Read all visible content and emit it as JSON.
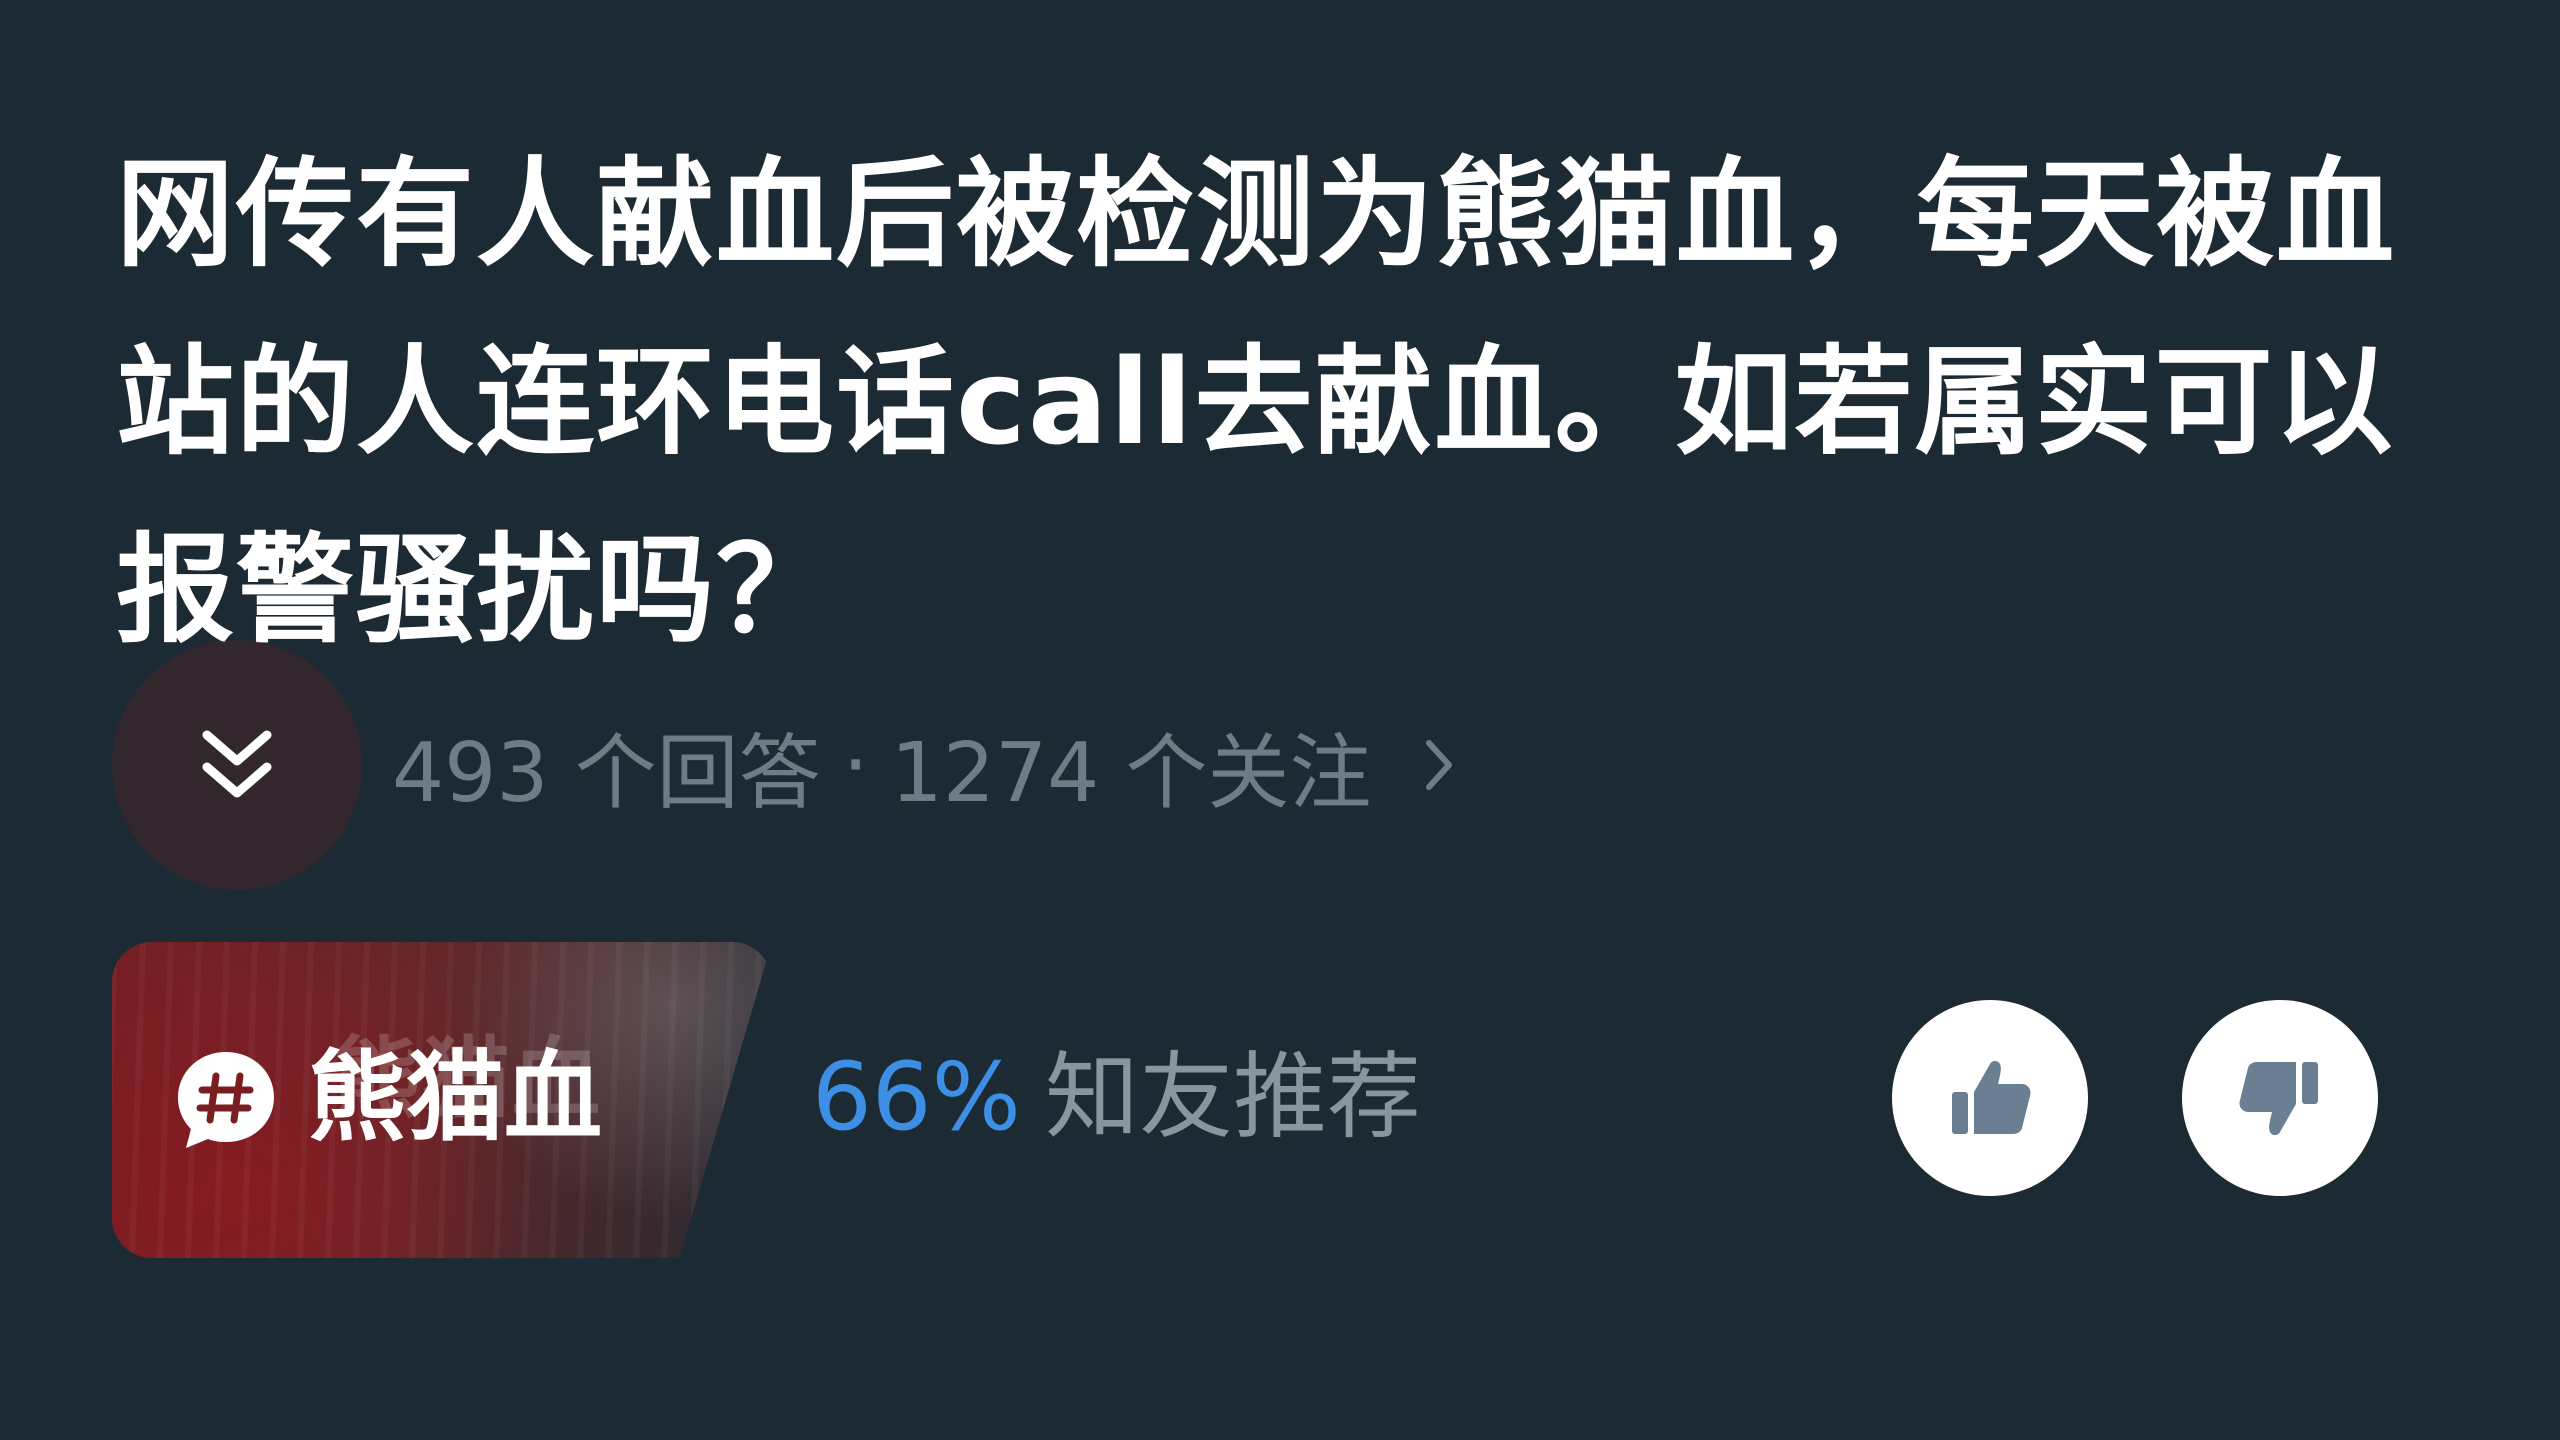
{
  "question": {
    "title": "网传有人献血后被检测为熊猫血，每天被血站的人连环电话call去献血。如若属实可以报警骚扰吗？"
  },
  "meta": {
    "answers": "493 个回答",
    "separator": "·",
    "followers": "1274 个关注",
    "expand_icon": "double-chevron-down-icon",
    "more_icon": "chevron-right-icon"
  },
  "topic": {
    "label": "熊猫血",
    "watermark": "熊猫血",
    "icon": "hash-chat-icon"
  },
  "recommendation": {
    "percent": "66%",
    "label": "知友推荐"
  },
  "votes": {
    "up_icon": "thumbs-up-icon",
    "down_icon": "thumbs-down-icon"
  },
  "colors": {
    "background": "#1c2a33",
    "accent": "#3d8fe6",
    "muted_text": "#6f7c86",
    "tag_red": "#7a1e22"
  }
}
